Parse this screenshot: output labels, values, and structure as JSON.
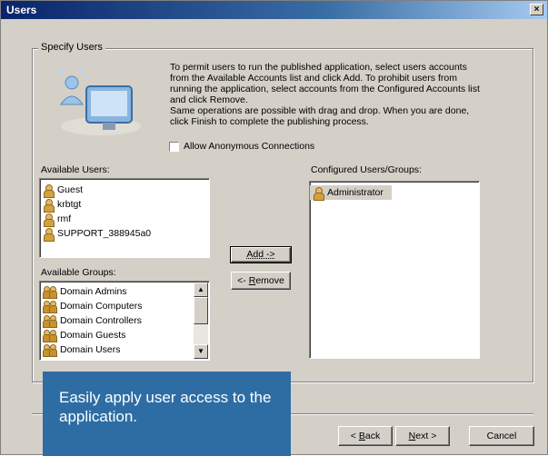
{
  "window": {
    "title": "Users",
    "close_glyph": "×"
  },
  "group": {
    "title": "Specify Users"
  },
  "description": "To permit users to run the published application, select users accounts from the Available Accounts list and click Add. To prohibit users from running the application, select accounts from the Configured Accounts list and click Remove.\nSame operations are possible with drag and drop. When you are done, click Finish to complete the publishing process.",
  "anonymous": {
    "label": "Allow Anonymous Connections",
    "checked": false
  },
  "available_users": {
    "label": "Available Users:",
    "items": [
      "Guest",
      "krbtgt",
      "rmf",
      "SUPPORT_388945a0"
    ]
  },
  "available_groups": {
    "label": "Available Groups:",
    "items": [
      "Domain Admins",
      "Domain Computers",
      "Domain Controllers",
      "Domain Guests",
      "Domain Users"
    ]
  },
  "configured": {
    "label": "Configured Users/Groups:",
    "items": [
      "Administrator"
    ]
  },
  "buttons": {
    "add": "Add ->",
    "remove_prefix": "<- ",
    "remove_mnemonic": "R",
    "remove_rest": "emove",
    "back_prefix": "< ",
    "back_mnemonic": "B",
    "back_rest": "ack",
    "next_mnemonic": "N",
    "next_rest": "ext >",
    "cancel": "Cancel"
  },
  "promo": {
    "text": "Easily apply user access to the application."
  },
  "colors": {
    "dialog_bg": "#d4d0c8",
    "title_bar": "#0a246a",
    "promo_bg": "#2e6da4"
  }
}
